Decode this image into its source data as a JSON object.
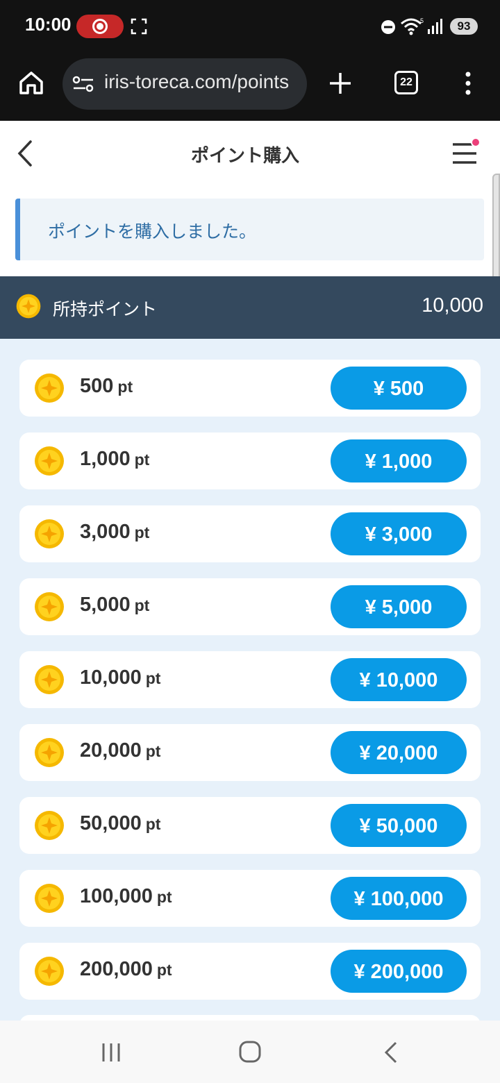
{
  "status_bar": {
    "time": "10:00",
    "battery": "93"
  },
  "browser": {
    "url": "iris-toreca.com/points",
    "tab_count": "22"
  },
  "header": {
    "title": "ポイント購入"
  },
  "alert": {
    "message": "ポイントを購入しました。"
  },
  "points": {
    "label": "所持ポイント",
    "value": "10,000"
  },
  "packages": [
    {
      "amount": "500",
      "unit": "pt",
      "price": "¥ 500"
    },
    {
      "amount": "1,000",
      "unit": "pt",
      "price": "¥ 1,000"
    },
    {
      "amount": "3,000",
      "unit": "pt",
      "price": "¥ 3,000"
    },
    {
      "amount": "5,000",
      "unit": "pt",
      "price": "¥ 5,000"
    },
    {
      "amount": "10,000",
      "unit": "pt",
      "price": "¥ 10,000"
    },
    {
      "amount": "20,000",
      "unit": "pt",
      "price": "¥ 20,000"
    },
    {
      "amount": "50,000",
      "unit": "pt",
      "price": "¥ 50,000"
    },
    {
      "amount": "100,000",
      "unit": "pt",
      "price": "¥ 100,000"
    },
    {
      "amount": "200,000",
      "unit": "pt",
      "price": "¥ 200,000"
    }
  ],
  "colors": {
    "accent": "#0a9be6",
    "points_bar": "#34495e",
    "alert_border": "#4a90d9",
    "background": "#e7f1fa"
  },
  "icons": {
    "coin": "coin-icon",
    "home": "home-icon",
    "back": "chevron-left-icon",
    "menu": "hamburger-icon"
  }
}
